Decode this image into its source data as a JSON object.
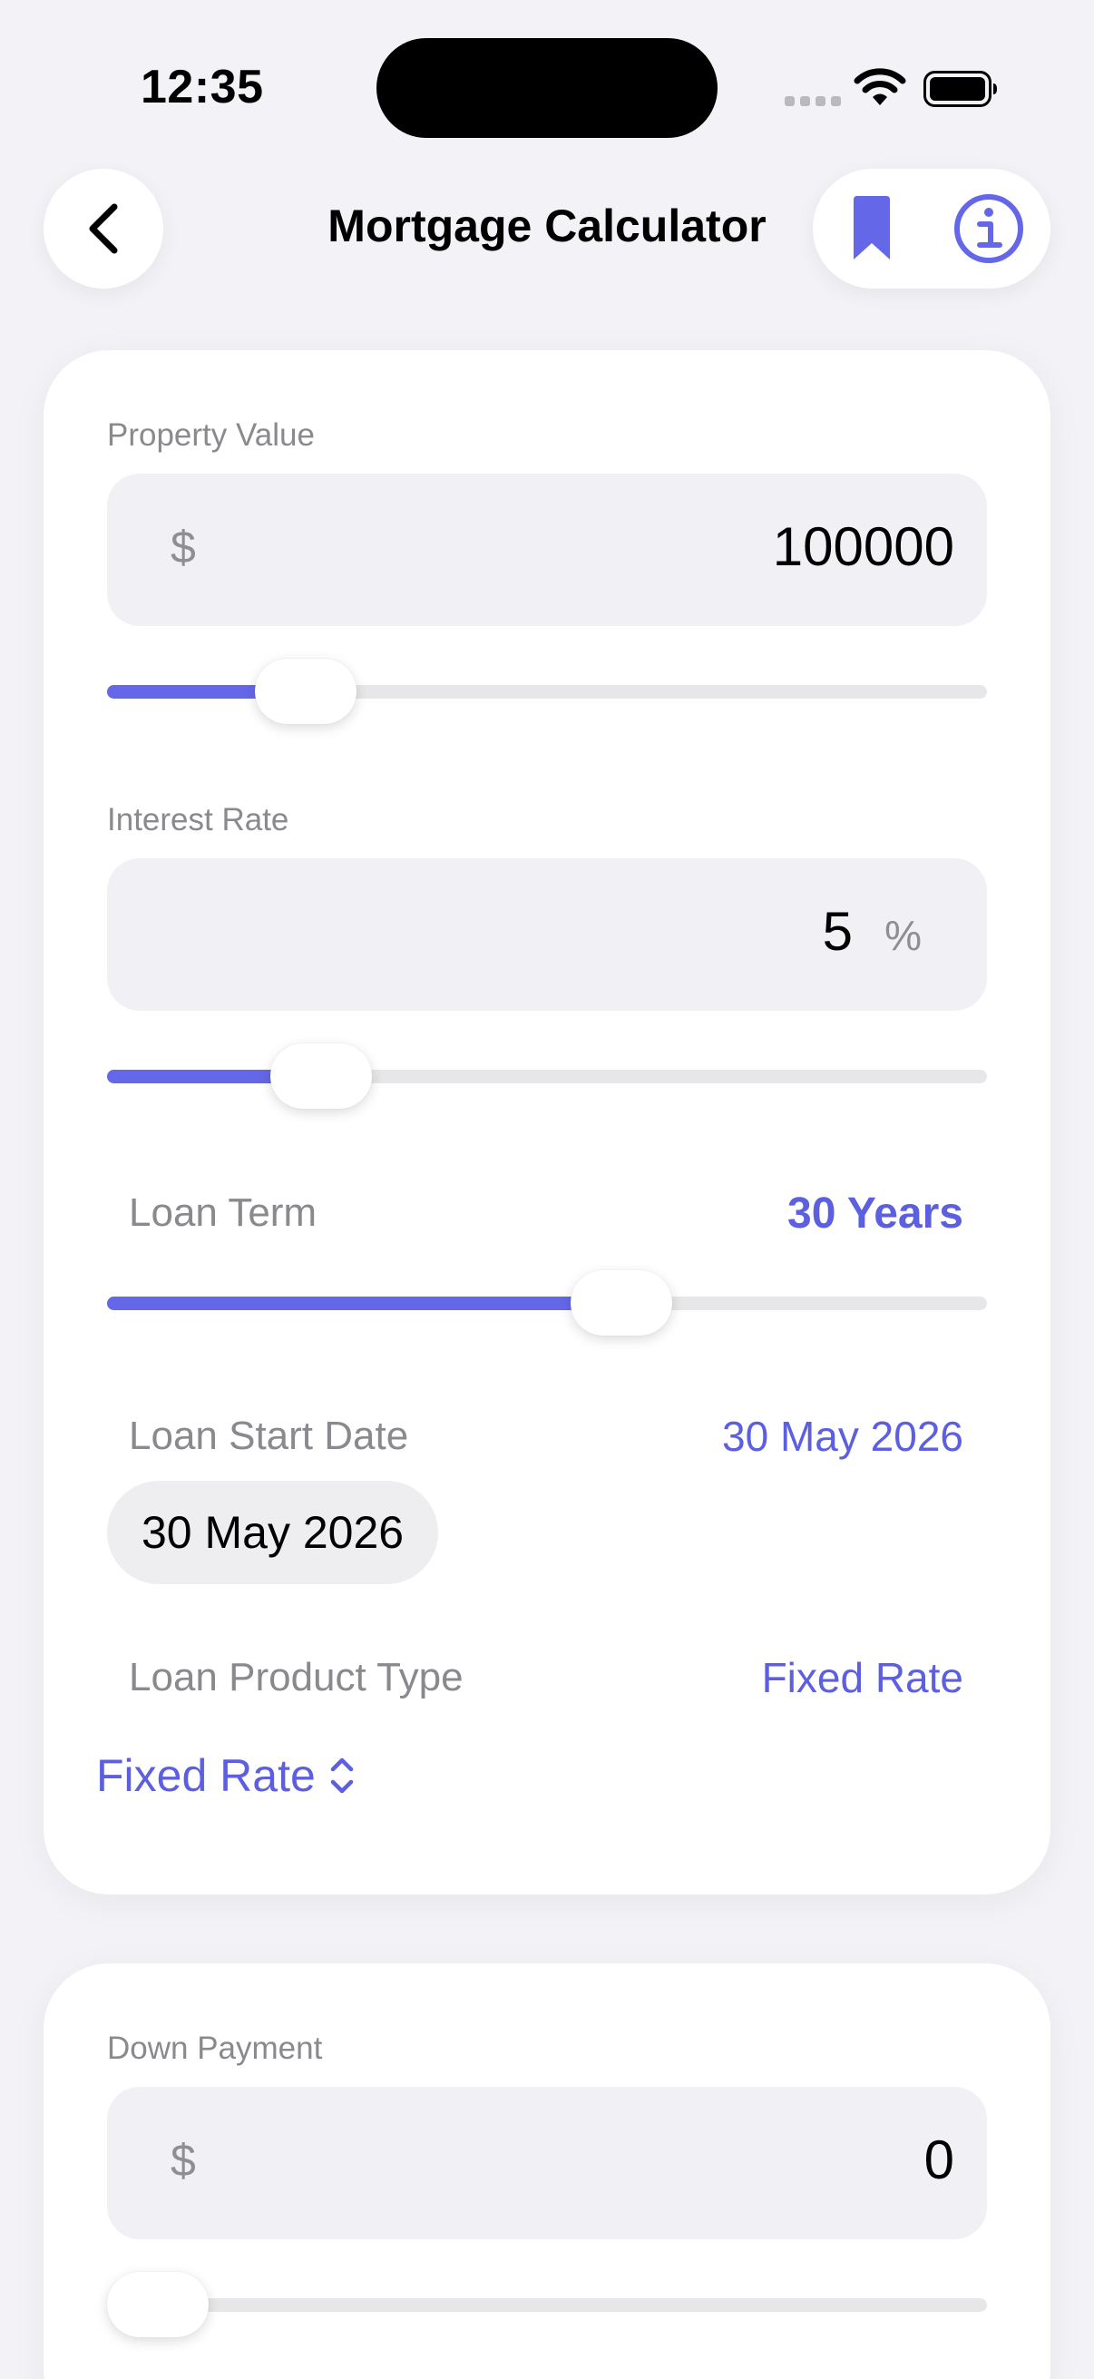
{
  "status_bar": {
    "time": "12:35"
  },
  "nav": {
    "title": "Mortgage Calculator"
  },
  "property_value": {
    "label": "Property Value",
    "prefix": "$",
    "value": "100000",
    "slider_fraction": 0.19
  },
  "interest_rate": {
    "label": "Interest Rate",
    "value": "5",
    "suffix": "%",
    "slider_fraction": 0.21
  },
  "loan_term": {
    "label": "Loan Term",
    "value": "30 Years",
    "slider_fraction": 0.595
  },
  "loan_start_date": {
    "label": "Loan Start Date",
    "value": "30 May 2026",
    "pill": "30 May 2026"
  },
  "loan_product_type": {
    "label": "Loan Product Type",
    "value": "Fixed Rate",
    "picker": "Fixed Rate"
  },
  "down_payment": {
    "label": "Down Payment",
    "prefix": "$",
    "value": "0",
    "slider_fraction": 0.0
  },
  "colors": {
    "accent": "#5c5fe0",
    "slider_fill": "#6468e8",
    "background": "#f2f2f7"
  },
  "icons": {
    "back": "chevron-left-icon",
    "bookmark": "bookmark-icon",
    "info": "info-circle-icon"
  }
}
